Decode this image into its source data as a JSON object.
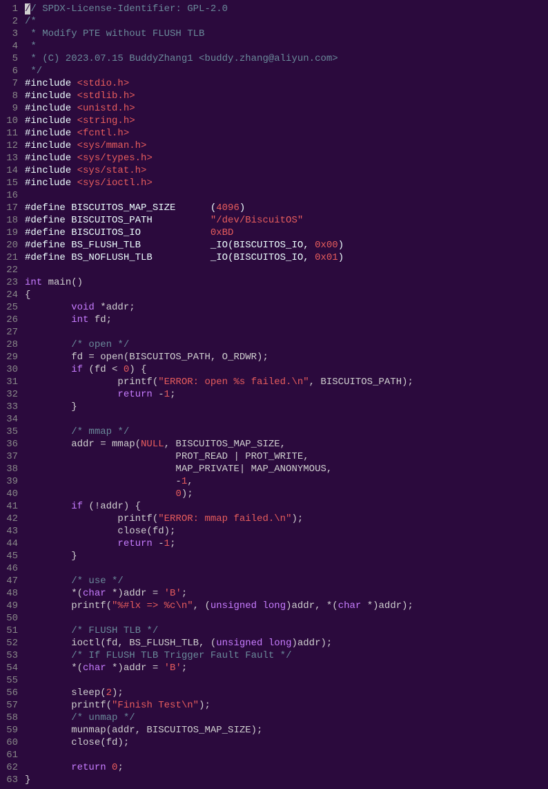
{
  "lines": [
    {
      "n": 1,
      "t": [
        {
          "c": "cursor",
          "s": "/"
        },
        {
          "c": "comment",
          "s": "/ SPDX-License-Identifier: GPL-2.0"
        }
      ]
    },
    {
      "n": 2,
      "t": [
        {
          "c": "comment",
          "s": "/*"
        }
      ]
    },
    {
      "n": 3,
      "t": [
        {
          "c": "comment",
          "s": " * Modify PTE without FLUSH TLB"
        }
      ]
    },
    {
      "n": 4,
      "t": [
        {
          "c": "comment",
          "s": " *"
        }
      ]
    },
    {
      "n": 5,
      "t": [
        {
          "c": "comment",
          "s": " * (C) 2023.07.15 BuddyZhang1 <buddy.zhang@aliyun.com>"
        }
      ]
    },
    {
      "n": 6,
      "t": [
        {
          "c": "comment",
          "s": " */"
        }
      ]
    },
    {
      "n": 7,
      "t": [
        {
          "c": "keyword",
          "s": "#include "
        },
        {
          "c": "include",
          "s": "<stdio.h>"
        }
      ]
    },
    {
      "n": 8,
      "t": [
        {
          "c": "keyword",
          "s": "#include "
        },
        {
          "c": "include",
          "s": "<stdlib.h>"
        }
      ]
    },
    {
      "n": 9,
      "t": [
        {
          "c": "keyword",
          "s": "#include "
        },
        {
          "c": "include",
          "s": "<unistd.h>"
        }
      ]
    },
    {
      "n": 10,
      "t": [
        {
          "c": "keyword",
          "s": "#include "
        },
        {
          "c": "include",
          "s": "<string.h>"
        }
      ]
    },
    {
      "n": 11,
      "t": [
        {
          "c": "keyword",
          "s": "#include "
        },
        {
          "c": "include",
          "s": "<fcntl.h>"
        }
      ]
    },
    {
      "n": 12,
      "t": [
        {
          "c": "keyword",
          "s": "#include "
        },
        {
          "c": "include",
          "s": "<sys/mman.h>"
        }
      ]
    },
    {
      "n": 13,
      "t": [
        {
          "c": "keyword",
          "s": "#include "
        },
        {
          "c": "include",
          "s": "<sys/types.h>"
        }
      ]
    },
    {
      "n": 14,
      "t": [
        {
          "c": "keyword",
          "s": "#include "
        },
        {
          "c": "include",
          "s": "<sys/stat.h>"
        }
      ]
    },
    {
      "n": 15,
      "t": [
        {
          "c": "keyword",
          "s": "#include "
        },
        {
          "c": "include",
          "s": "<sys/ioctl.h>"
        }
      ]
    },
    {
      "n": 16,
      "t": [
        {
          "c": "default",
          "s": ""
        }
      ]
    },
    {
      "n": 17,
      "t": [
        {
          "c": "keyword",
          "s": "#define BISCUITOS_MAP_SIZE      ("
        },
        {
          "c": "number",
          "s": "4096"
        },
        {
          "c": "keyword",
          "s": ")"
        }
      ]
    },
    {
      "n": 18,
      "t": [
        {
          "c": "keyword",
          "s": "#define BISCUITOS_PATH          "
        },
        {
          "c": "string",
          "s": "\"/dev/BiscuitOS\""
        }
      ]
    },
    {
      "n": 19,
      "t": [
        {
          "c": "keyword",
          "s": "#define BISCUITOS_IO            "
        },
        {
          "c": "number",
          "s": "0xBD"
        }
      ]
    },
    {
      "n": 20,
      "t": [
        {
          "c": "keyword",
          "s": "#define BS_FLUSH_TLB            _IO(BISCUITOS_IO, "
        },
        {
          "c": "number",
          "s": "0x00"
        },
        {
          "c": "keyword",
          "s": ")"
        }
      ]
    },
    {
      "n": 21,
      "t": [
        {
          "c": "keyword",
          "s": "#define BS_NOFLUSH_TLB          _IO(BISCUITOS_IO, "
        },
        {
          "c": "number",
          "s": "0x01"
        },
        {
          "c": "keyword",
          "s": ")"
        }
      ]
    },
    {
      "n": 22,
      "t": [
        {
          "c": "default",
          "s": ""
        }
      ]
    },
    {
      "n": 23,
      "t": [
        {
          "c": "type",
          "s": "int"
        },
        {
          "c": "default",
          "s": " main()"
        }
      ]
    },
    {
      "n": 24,
      "t": [
        {
          "c": "default",
          "s": "{"
        }
      ]
    },
    {
      "n": 25,
      "t": [
        {
          "c": "default",
          "s": "        "
        },
        {
          "c": "type",
          "s": "void"
        },
        {
          "c": "default",
          "s": " *addr;"
        }
      ]
    },
    {
      "n": 26,
      "t": [
        {
          "c": "default",
          "s": "        "
        },
        {
          "c": "type",
          "s": "int"
        },
        {
          "c": "default",
          "s": " fd;"
        }
      ]
    },
    {
      "n": 27,
      "t": [
        {
          "c": "default",
          "s": ""
        }
      ]
    },
    {
      "n": 28,
      "t": [
        {
          "c": "default",
          "s": "        "
        },
        {
          "c": "comment",
          "s": "/* open */"
        }
      ]
    },
    {
      "n": 29,
      "t": [
        {
          "c": "default",
          "s": "        fd = open(BISCUITOS_PATH, O_RDWR);"
        }
      ]
    },
    {
      "n": 30,
      "t": [
        {
          "c": "default",
          "s": "        "
        },
        {
          "c": "type",
          "s": "if"
        },
        {
          "c": "default",
          "s": " (fd < "
        },
        {
          "c": "number",
          "s": "0"
        },
        {
          "c": "default",
          "s": ") {"
        }
      ]
    },
    {
      "n": 31,
      "t": [
        {
          "c": "default",
          "s": "                printf("
        },
        {
          "c": "string",
          "s": "\"ERROR: open %s failed.\\n\""
        },
        {
          "c": "default",
          "s": ", BISCUITOS_PATH);"
        }
      ]
    },
    {
      "n": 32,
      "t": [
        {
          "c": "default",
          "s": "                "
        },
        {
          "c": "type",
          "s": "return"
        },
        {
          "c": "default",
          "s": " -"
        },
        {
          "c": "number",
          "s": "1"
        },
        {
          "c": "default",
          "s": ";"
        }
      ]
    },
    {
      "n": 33,
      "t": [
        {
          "c": "default",
          "s": "        }"
        }
      ]
    },
    {
      "n": 34,
      "t": [
        {
          "c": "default",
          "s": ""
        }
      ]
    },
    {
      "n": 35,
      "t": [
        {
          "c": "default",
          "s": "        "
        },
        {
          "c": "comment",
          "s": "/* mmap */"
        }
      ]
    },
    {
      "n": 36,
      "t": [
        {
          "c": "default",
          "s": "        addr = mmap("
        },
        {
          "c": "number",
          "s": "NULL"
        },
        {
          "c": "default",
          "s": ", BISCUITOS_MAP_SIZE,"
        }
      ]
    },
    {
      "n": 37,
      "t": [
        {
          "c": "default",
          "s": "                          PROT_READ | PROT_WRITE,"
        }
      ]
    },
    {
      "n": 38,
      "t": [
        {
          "c": "default",
          "s": "                          MAP_PRIVATE| MAP_ANONYMOUS,"
        }
      ]
    },
    {
      "n": 39,
      "t": [
        {
          "c": "default",
          "s": "                          -"
        },
        {
          "c": "number",
          "s": "1"
        },
        {
          "c": "default",
          "s": ","
        }
      ]
    },
    {
      "n": 40,
      "t": [
        {
          "c": "default",
          "s": "                          "
        },
        {
          "c": "number",
          "s": "0"
        },
        {
          "c": "default",
          "s": ");"
        }
      ]
    },
    {
      "n": 41,
      "t": [
        {
          "c": "default",
          "s": "        "
        },
        {
          "c": "type",
          "s": "if"
        },
        {
          "c": "default",
          "s": " (!addr) {"
        }
      ]
    },
    {
      "n": 42,
      "t": [
        {
          "c": "default",
          "s": "                printf("
        },
        {
          "c": "string",
          "s": "\"ERROR: mmap failed.\\n\""
        },
        {
          "c": "default",
          "s": ");"
        }
      ]
    },
    {
      "n": 43,
      "t": [
        {
          "c": "default",
          "s": "                close(fd);"
        }
      ]
    },
    {
      "n": 44,
      "t": [
        {
          "c": "default",
          "s": "                "
        },
        {
          "c": "type",
          "s": "return"
        },
        {
          "c": "default",
          "s": " -"
        },
        {
          "c": "number",
          "s": "1"
        },
        {
          "c": "default",
          "s": ";"
        }
      ]
    },
    {
      "n": 45,
      "t": [
        {
          "c": "default",
          "s": "        }"
        }
      ]
    },
    {
      "n": 46,
      "t": [
        {
          "c": "default",
          "s": ""
        }
      ]
    },
    {
      "n": 47,
      "t": [
        {
          "c": "default",
          "s": "        "
        },
        {
          "c": "comment",
          "s": "/* use */"
        }
      ]
    },
    {
      "n": 48,
      "t": [
        {
          "c": "default",
          "s": "        *("
        },
        {
          "c": "type",
          "s": "char"
        },
        {
          "c": "default",
          "s": " *)addr = "
        },
        {
          "c": "string",
          "s": "'B'"
        },
        {
          "c": "default",
          "s": ";"
        }
      ]
    },
    {
      "n": 49,
      "t": [
        {
          "c": "default",
          "s": "        printf("
        },
        {
          "c": "string",
          "s": "\"%#lx => %c\\n\""
        },
        {
          "c": "default",
          "s": ", ("
        },
        {
          "c": "type",
          "s": "unsigned long"
        },
        {
          "c": "default",
          "s": ")addr, *("
        },
        {
          "c": "type",
          "s": "char"
        },
        {
          "c": "default",
          "s": " *)addr);"
        }
      ]
    },
    {
      "n": 50,
      "t": [
        {
          "c": "default",
          "s": ""
        }
      ]
    },
    {
      "n": 51,
      "t": [
        {
          "c": "default",
          "s": "        "
        },
        {
          "c": "comment",
          "s": "/* FLUSH TLB */"
        }
      ]
    },
    {
      "n": 52,
      "t": [
        {
          "c": "default",
          "s": "        ioctl(fd, BS_FLUSH_TLB, ("
        },
        {
          "c": "type",
          "s": "unsigned long"
        },
        {
          "c": "default",
          "s": ")addr);"
        }
      ]
    },
    {
      "n": 53,
      "t": [
        {
          "c": "default",
          "s": "        "
        },
        {
          "c": "comment",
          "s": "/* If FLUSH TLB Trigger Fault Fault */"
        }
      ]
    },
    {
      "n": 54,
      "t": [
        {
          "c": "default",
          "s": "        *("
        },
        {
          "c": "type",
          "s": "char"
        },
        {
          "c": "default",
          "s": " *)addr = "
        },
        {
          "c": "string",
          "s": "'B'"
        },
        {
          "c": "default",
          "s": ";"
        }
      ]
    },
    {
      "n": 55,
      "t": [
        {
          "c": "default",
          "s": ""
        }
      ]
    },
    {
      "n": 56,
      "t": [
        {
          "c": "default",
          "s": "        sleep("
        },
        {
          "c": "number",
          "s": "2"
        },
        {
          "c": "default",
          "s": ");"
        }
      ]
    },
    {
      "n": 57,
      "t": [
        {
          "c": "default",
          "s": "        printf("
        },
        {
          "c": "string",
          "s": "\"Finish Test\\n\""
        },
        {
          "c": "default",
          "s": ");"
        }
      ]
    },
    {
      "n": 58,
      "t": [
        {
          "c": "default",
          "s": "        "
        },
        {
          "c": "comment",
          "s": "/* unmap */"
        }
      ]
    },
    {
      "n": 59,
      "t": [
        {
          "c": "default",
          "s": "        munmap(addr, BISCUITOS_MAP_SIZE);"
        }
      ]
    },
    {
      "n": 60,
      "t": [
        {
          "c": "default",
          "s": "        close(fd);"
        }
      ]
    },
    {
      "n": 61,
      "t": [
        {
          "c": "default",
          "s": ""
        }
      ]
    },
    {
      "n": 62,
      "t": [
        {
          "c": "default",
          "s": "        "
        },
        {
          "c": "type",
          "s": "return"
        },
        {
          "c": "default",
          "s": " "
        },
        {
          "c": "number",
          "s": "0"
        },
        {
          "c": "default",
          "s": ";"
        }
      ]
    },
    {
      "n": 63,
      "t": [
        {
          "c": "default",
          "s": "}"
        }
      ]
    }
  ]
}
